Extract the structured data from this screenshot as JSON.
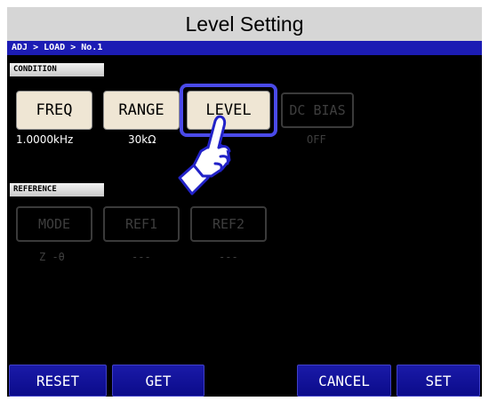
{
  "window": {
    "title": "Level Setting"
  },
  "breadcrumb": "ADJ > LOAD > No.1",
  "condition": {
    "label": "CONDITION",
    "buttons": [
      {
        "label": "FREQ",
        "value": "1.0000kHz",
        "enabled": true
      },
      {
        "label": "RANGE",
        "value": "30kΩ",
        "enabled": true
      },
      {
        "label": "LEVEL",
        "value": "",
        "enabled": true,
        "highlighted": true
      },
      {
        "label": "DC BIAS",
        "value": "OFF",
        "enabled": false
      }
    ]
  },
  "reference": {
    "label": "REFERENCE",
    "buttons": [
      {
        "label": "MODE",
        "value": "Z -θ",
        "enabled": false
      },
      {
        "label": "REF1",
        "value": "---",
        "enabled": false
      },
      {
        "label": "REF2",
        "value": "---",
        "enabled": false
      }
    ]
  },
  "footer": {
    "reset": "RESET",
    "get": "GET",
    "cancel": "CANCEL",
    "set": "SET"
  },
  "colors": {
    "title_bar": "#d6d6d6",
    "breadcrumb_bg": "#1c1cb4",
    "screen_bg": "#000000",
    "active_button": "#efe6d4",
    "highlight": "#4a4ae8",
    "footer_button": "#1414a0"
  },
  "icons": {
    "pointer": "pointing-hand-icon"
  }
}
